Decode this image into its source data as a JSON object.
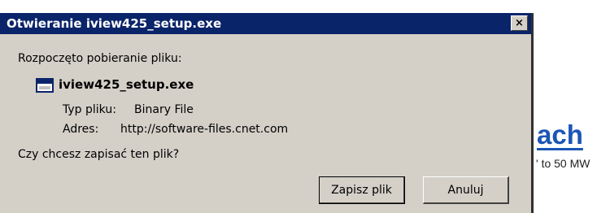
{
  "background_page": {
    "link_text": "ach",
    "text_fragment": "' to 50 MW"
  },
  "dialog": {
    "title": "Otwieranie iview425_setup.exe",
    "close_glyph": "×",
    "started_text": "Rozpoczęto pobieranie pliku:",
    "file_icon": "window-file-icon",
    "filename": "iview425_setup.exe",
    "file_type_label": "Typ pliku:",
    "file_type_value": "Binary File",
    "address_label": "Adres:",
    "address_value": "http://software-files.cnet.com",
    "question": "Czy chcesz zapisać ten plik?",
    "save_button": "Zapisz plik",
    "cancel_button": "Anuluj"
  },
  "colors": {
    "titlebar": "#0a246a",
    "dialog_bg": "#d4d0c8",
    "link": "#1a56b5"
  }
}
